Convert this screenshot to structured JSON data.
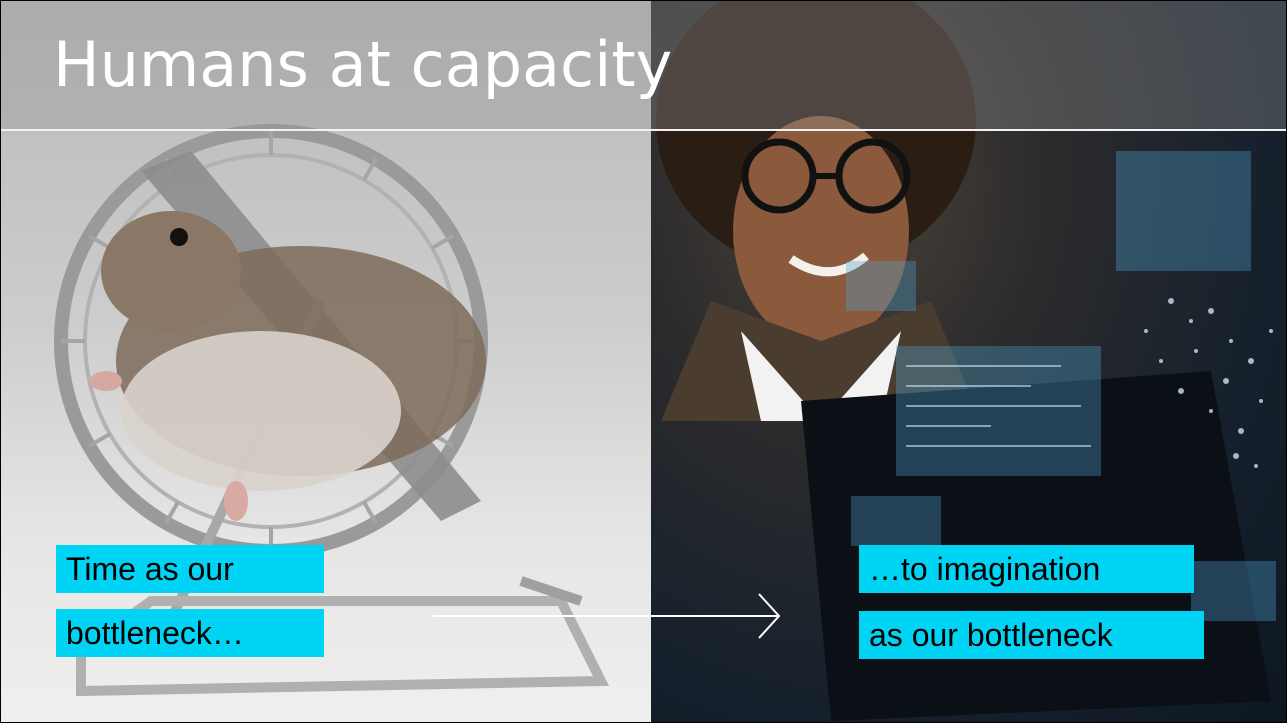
{
  "slide": {
    "title": "Humans at capacity",
    "left_caption": {
      "line1": "Time as our",
      "line2": "bottleneck…"
    },
    "right_caption": {
      "line1": "…to imagination",
      "line2": "as our bottleneck"
    }
  },
  "colors": {
    "caption_highlight": "#00d4f5",
    "title_text": "#ffffff",
    "left_background": "#d3d3d3",
    "right_background": "#16202b",
    "arrow": "#ffffff"
  },
  "images": {
    "left": "hamster-in-wheel-photo",
    "right": "woman-with-laptop-and-code-overlay-photo"
  }
}
